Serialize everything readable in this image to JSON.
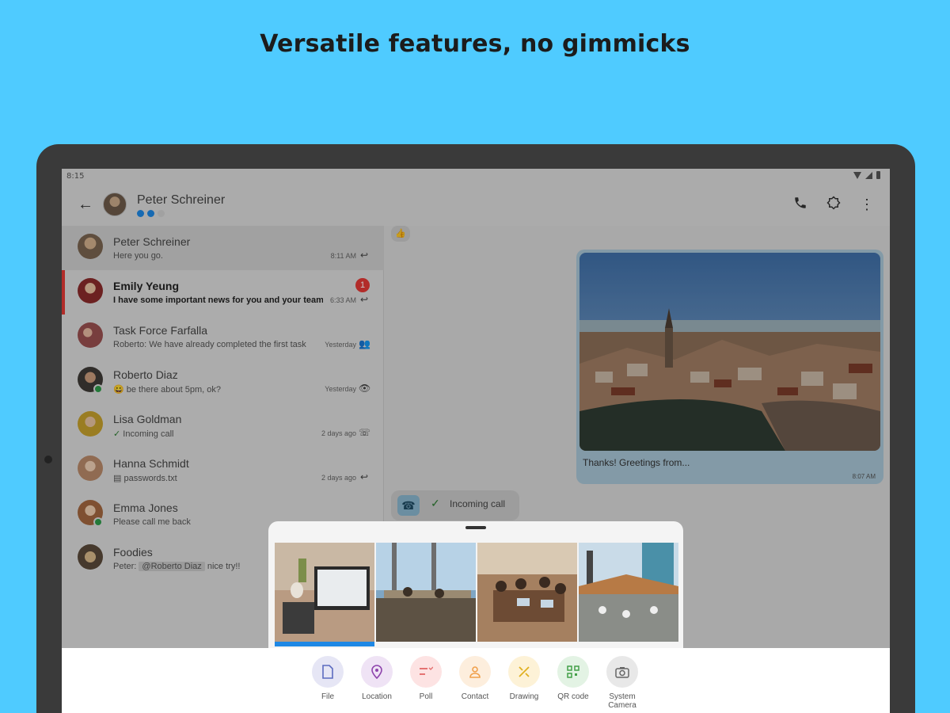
{
  "headline": "Versatile features, no gimmicks",
  "statusbar": {
    "time": "8:15"
  },
  "header": {
    "contact_name": "Peter Schreiner",
    "back_icon": "arrow-back-icon",
    "actions": [
      "phone-call-icon",
      "security-badge-icon",
      "more-vert-icon"
    ],
    "verification_dots": [
      "#1e88e5",
      "#1e88e5",
      "#cfcfcf"
    ]
  },
  "conversations": [
    {
      "name": "Peter Schreiner",
      "snippet": "Here you go.",
      "time": "8:11 AM",
      "icon": "reply-icon",
      "selected": true
    },
    {
      "name": "Emily Yeung",
      "snippet": "I have some important news for you and your team",
      "time": "6:33 AM",
      "icon": "reply-icon",
      "unread": "1"
    },
    {
      "name": "Task Force Farfalla",
      "snippet": "Roberto: We have already completed the first task",
      "time": "Yesterday",
      "icon": "group-icon"
    },
    {
      "name": "Roberto Diaz",
      "snippet": "be there about 5pm, ok?",
      "time": "Yesterday",
      "icon": "eye-icon",
      "emoji": "😀"
    },
    {
      "name": "Lisa Goldman",
      "snippet": "Incoming call",
      "time": "2 days ago",
      "icon": "phone-icon",
      "prefix": "✓"
    },
    {
      "name": "Hanna Schmidt",
      "snippet": "passwords.txt",
      "time": "2 days ago",
      "icon": "reply-icon",
      "prefix": "▤"
    },
    {
      "name": "Emma Jones",
      "snippet": "Please call me back",
      "time": "",
      "icon": ""
    },
    {
      "name": "Foodies",
      "snippet_before": "Peter:",
      "mention": "@Roberto Diaz",
      "snippet_after": "nice try!!",
      "time": "",
      "icon": ""
    }
  ],
  "chat": {
    "emoji_reaction": "👍",
    "image_caption": "Thanks! Greetings from...",
    "image_meta": "8:07 AM",
    "call_text": "Incoming call"
  },
  "attachments": [
    {
      "label": "File",
      "icon": "file-icon",
      "bg": "#e6e6f5",
      "fg": "#5c6bc0"
    },
    {
      "label": "Location",
      "icon": "location-pin-icon",
      "bg": "#efe3f5",
      "fg": "#8e44ad"
    },
    {
      "label": "Poll",
      "icon": "poll-icon",
      "bg": "#fde3e3",
      "fg": "#e57373"
    },
    {
      "label": "Contact",
      "icon": "contact-icon",
      "bg": "#fdeedd",
      "fg": "#f0a04b"
    },
    {
      "label": "Drawing",
      "icon": "drawing-icon",
      "bg": "#fdf2d7",
      "fg": "#e0b020"
    },
    {
      "label": "QR code",
      "icon": "qr-code-icon",
      "bg": "#e3f3e4",
      "fg": "#43a047"
    },
    {
      "label": "System Camera",
      "icon": "camera-icon",
      "bg": "#e8e8e8",
      "fg": "#666666"
    }
  ]
}
